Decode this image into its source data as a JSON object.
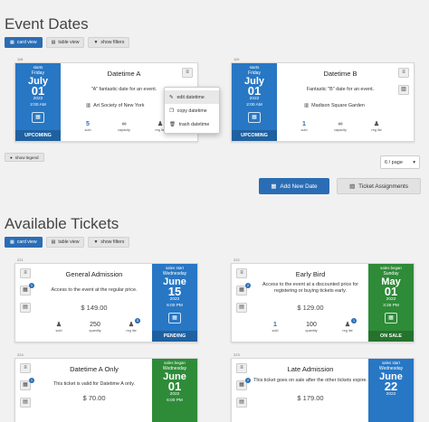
{
  "event_dates": {
    "title": "Event Dates",
    "view_buttons": {
      "card_view": "card view",
      "table_view": "table view",
      "show_filters": "show filters"
    },
    "dates": [
      {
        "id": "118",
        "name": "Datetime A",
        "label": "starts",
        "weekday": "Friday",
        "month": "July",
        "day": "01",
        "year": "2022",
        "time": "2:00 AM",
        "status": "UPCOMING",
        "description": "\"A\" fantastic date for an event.",
        "venue": "Art Society of New York",
        "sold": "5",
        "sold_label": "sold",
        "capacity_label": "capacity",
        "reglist_label": "reg list"
      },
      {
        "id": "119",
        "name": "Datetime B",
        "label": "starts",
        "weekday": "Friday",
        "month": "July",
        "day": "01",
        "year": "2022",
        "time": "2:00 AM",
        "status": "UPCOMING",
        "description": "Fantastic \"B\" date for an event.",
        "venue": "Madison Square Garden",
        "sold": "1",
        "sold_label": "sold",
        "capacity_label": "capacity",
        "reglist_label": "reg list"
      }
    ],
    "menu": {
      "edit": "edit datetime",
      "copy": "copy datetime",
      "trash": "trash datetime"
    },
    "show_legend": "show legend",
    "per_page": "6 / page",
    "add_new_date": "Add New Date",
    "ticket_assignments": "Ticket Assignments"
  },
  "tickets": {
    "title": "Available Tickets",
    "view_buttons": {
      "card_view": "card view",
      "table_view": "table view",
      "show_filters": "show filters"
    },
    "items": [
      {
        "id": "221",
        "name": "General Admission",
        "description": "Access to the event at the regular price.",
        "price": "$ 149.00",
        "label": "sales start",
        "weekday": "Wednesday",
        "month": "June",
        "day": "15",
        "year": "2022",
        "time": "6:00 PM",
        "status": "PENDING",
        "color": "blue",
        "sold": "0",
        "quantity": "250",
        "badge": "1",
        "reg_badge": "5"
      },
      {
        "id": "222",
        "name": "Early Bird",
        "description": "Access to the event at a discounted price for registering or buying tickets early.",
        "price": "$ 129.00",
        "label": "sales began",
        "weekday": "Sunday",
        "month": "May",
        "day": "01",
        "year": "2022",
        "time": "3:26 PM",
        "status": "ON SALE",
        "color": "green",
        "sold": "1",
        "quantity": "100",
        "badge": "2",
        "reg_badge": "1"
      },
      {
        "id": "224",
        "name": "Datetime A Only",
        "description": "This ticket is valid for Datetime A only.",
        "price": "$ 70.00",
        "label": "sales began",
        "weekday": "Wednesday",
        "month": "June",
        "day": "01",
        "year": "2022",
        "time": "6:00 PM",
        "status": "",
        "color": "green",
        "badge": "1"
      },
      {
        "id": "223",
        "name": "Late Admission",
        "description": "This ticket goes on sale after the other tickets expire.",
        "price": "$ 179.00",
        "label": "sales start",
        "weekday": "Wednesday",
        "month": "June",
        "day": "22",
        "year": "2022",
        "time": "",
        "status": "",
        "color": "blue",
        "badge": "2"
      }
    ],
    "sold_label": "sold",
    "quantity_label": "quantity",
    "reglist_label": "reg list"
  }
}
